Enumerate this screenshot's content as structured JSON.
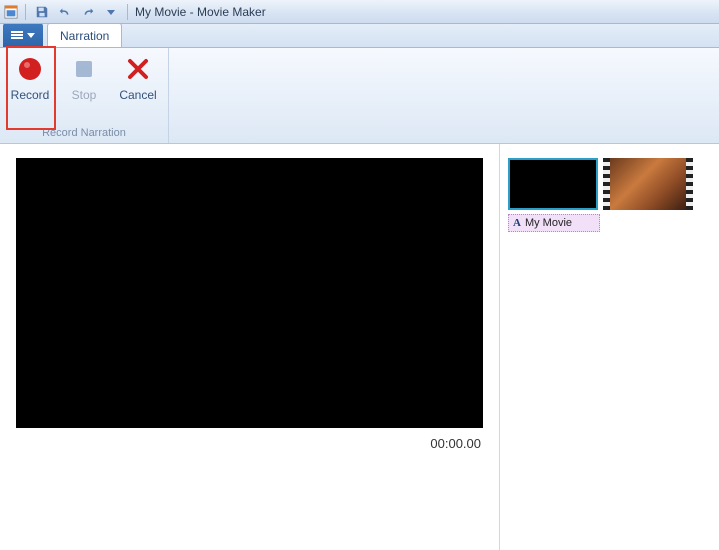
{
  "titlebar": {
    "title": "My Movie - Movie Maker"
  },
  "file_menu": {
    "aria": "File menu"
  },
  "tabs": {
    "narration": "Narration"
  },
  "ribbon": {
    "record_label": "Record",
    "stop_label": "Stop",
    "cancel_label": "Cancel",
    "group_label": "Record Narration"
  },
  "preview": {
    "time": "00:00.00"
  },
  "storyboard": {
    "title_chip": "My Movie"
  }
}
